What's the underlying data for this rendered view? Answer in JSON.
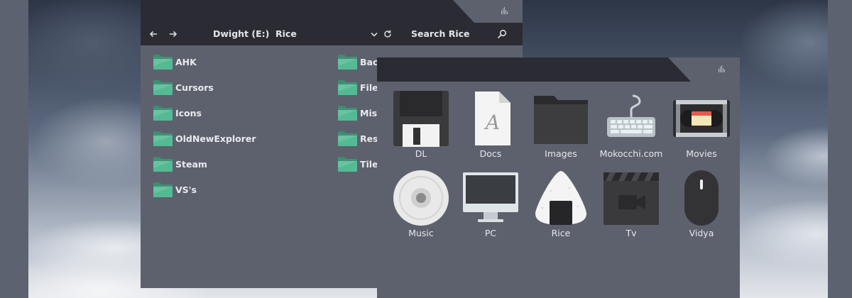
{
  "colors": {
    "titlebar": "#2b2c33",
    "window_bg": "#5d616d",
    "folder_green": "#54ba93",
    "text": "#e8eaee"
  },
  "explorer": {
    "nav": {
      "back_icon": "arrow-left-icon",
      "forward_icon": "arrow-right-icon"
    },
    "breadcrumb": {
      "drive": "Dwight (E:)",
      "folder": "Rice"
    },
    "search": {
      "label": "Search Rice"
    },
    "folders_left": [
      "AHK",
      "Cursors",
      "Icons",
      "OldNewExplorer",
      "Steam",
      "VS's"
    ],
    "folders_right": [
      "Back",
      "FileT",
      "Misc",
      "Reso",
      "Tiles"
    ]
  },
  "iconview": {
    "items": [
      {
        "label": "DL",
        "icon": "floppy-disk-icon"
      },
      {
        "label": "Docs",
        "icon": "document-icon",
        "glyph": "A"
      },
      {
        "label": "Images",
        "icon": "folder-icon"
      },
      {
        "label": "Mokocchi.com",
        "icon": "keyboard-icon"
      },
      {
        "label": "Movies",
        "icon": "vhs-tape-icon"
      },
      {
        "label": "Music",
        "icon": "cd-disc-icon"
      },
      {
        "label": "PC",
        "icon": "monitor-icon"
      },
      {
        "label": "Rice",
        "icon": "onigiri-icon"
      },
      {
        "label": "Tv",
        "icon": "clapperboard-icon"
      },
      {
        "label": "Vidya",
        "icon": "mouse-icon"
      }
    ]
  }
}
